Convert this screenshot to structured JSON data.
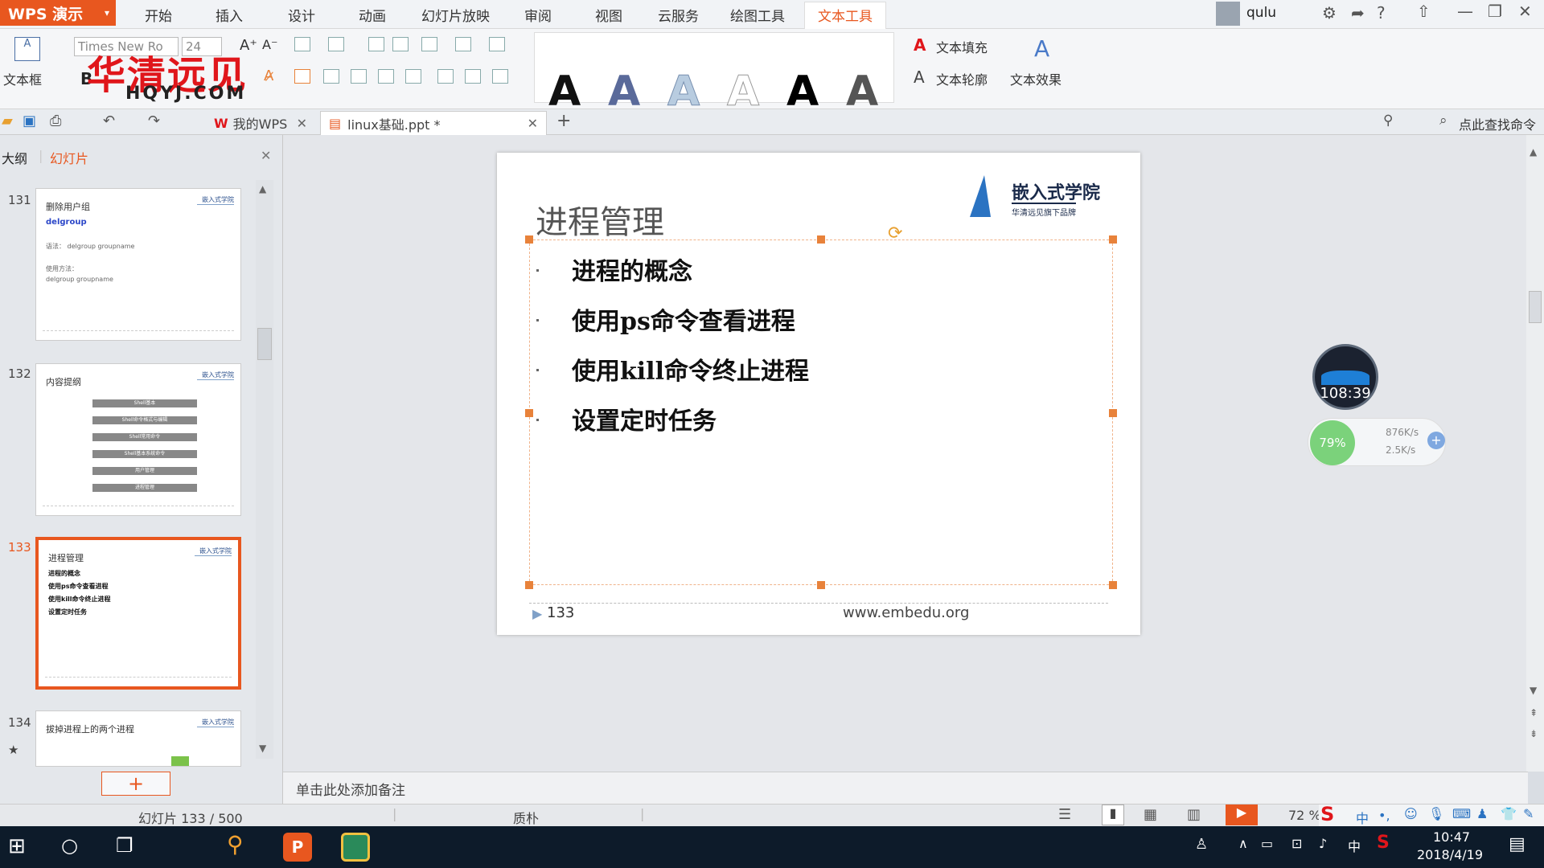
{
  "app": {
    "name": "WPS 演示"
  },
  "menu": [
    "开始",
    "插入",
    "设计",
    "动画",
    "幻灯片放映",
    "审阅",
    "视图",
    "云服务",
    "绘图工具",
    "文本工具"
  ],
  "menu_active": "文本工具",
  "user": {
    "name": "qulu"
  },
  "ribbon": {
    "textbox_label": "文本框",
    "font_name": "Times New Ro",
    "font_size": "24",
    "bold": "B",
    "text_fill": "文本填充",
    "text_outline": "文本轮廓",
    "text_effect": "文本效果",
    "styles": [
      "A",
      "A",
      "A",
      "A",
      "A",
      "A"
    ]
  },
  "watermark": {
    "main": "华清远见",
    "sub": "HQYJ.COM"
  },
  "doc_tabs": [
    {
      "label": "我的WPS"
    },
    {
      "label": "linux基础.ppt *"
    }
  ],
  "search": {
    "placeholder": "点此查找命令"
  },
  "panel": {
    "tab_outline": "大纲",
    "tab_slides": "幻灯片"
  },
  "thumbnails": [
    {
      "num": "131",
      "title": "删除用户组",
      "lines": [
        "delgroup",
        "语法： delgroup groupname",
        "使用方法：",
        "delgroup groupname"
      ]
    },
    {
      "num": "132",
      "title": "内容提纲",
      "bars": [
        "Shell基本",
        "Shell命令格式与编辑",
        "Shell常用命令",
        "Shell基本系统命令",
        "用户管理",
        "进程管理"
      ]
    },
    {
      "num": "133",
      "title": "进程管理",
      "lines": [
        "进程的概念",
        "使用ps命令查看进程",
        "使用kill命令终止进程",
        "设置定时任务"
      ]
    },
    {
      "num": "134",
      "title": "拔掉进程上的两个进程",
      "star": "★"
    }
  ],
  "slide": {
    "title": "进程管理",
    "logo_main": "嵌入式学院",
    "logo_sub": "华清远见旗下品牌",
    "bullets": [
      "进程的概念",
      "使用ps命令查看进程",
      "使用kill命令终止进程",
      "设置定时任务"
    ],
    "footer_num": "133",
    "footer_url": "www.embedu.org"
  },
  "notes": {
    "placeholder": "单击此处添加备注"
  },
  "status": {
    "slide_info": "幻灯片 133 / 500",
    "theme": "质朴",
    "zoom": "72 %"
  },
  "widget": {
    "timer": "108:39",
    "cpu": "79%",
    "up": "876K/s",
    "down": "2.5K/s"
  },
  "taskbar": {
    "time": "10:47",
    "date": "2018/4/19",
    "ime": "中"
  },
  "colors": {
    "accent": "#e8571f",
    "taskbar": "#0d1b2a",
    "logo_blue": "#2b73c2"
  }
}
